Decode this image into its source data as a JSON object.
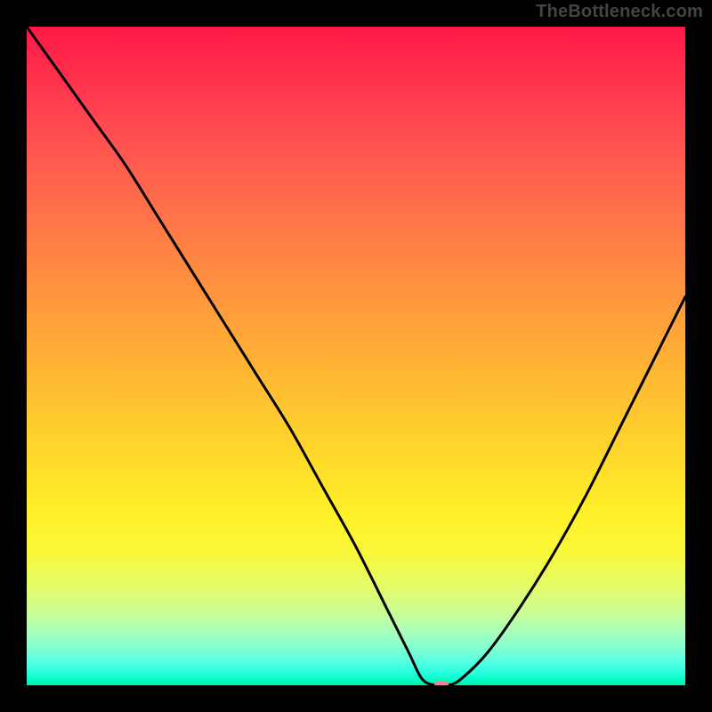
{
  "watermark": "TheBottleneck.com",
  "chart_data": {
    "type": "line",
    "title": "",
    "xlabel": "",
    "ylabel": "",
    "x_range": [
      0,
      100
    ],
    "y_range": [
      0,
      100
    ],
    "legend": false,
    "grid": false,
    "background_gradient": {
      "top_color": "#ff1846",
      "bottom_color": "#00f0a8",
      "description": "vertical red-to-green gradient"
    },
    "series": [
      {
        "name": "bottleneck-curve",
        "color": "#000000",
        "x": [
          0,
          5,
          10,
          15,
          20,
          25,
          30,
          35,
          40,
          45,
          50,
          55,
          58,
          60,
          62,
          64,
          66,
          70,
          75,
          80,
          85,
          90,
          95,
          100
        ],
        "values": [
          100,
          93,
          86,
          79,
          71,
          63,
          55,
          47,
          39,
          30,
          21,
          11,
          5,
          1,
          0,
          0,
          1,
          5,
          12,
          20,
          29,
          39,
          49,
          59
        ]
      }
    ],
    "marker": {
      "x": 63,
      "y": 0,
      "color": "#ff7b8a",
      "shape": "rounded-rect"
    }
  }
}
